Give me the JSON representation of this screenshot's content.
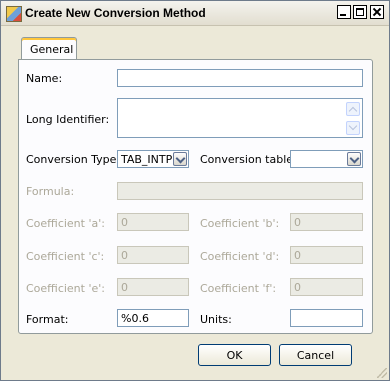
{
  "window": {
    "title": "Create New Conversion Method"
  },
  "tabs": [
    {
      "label": "General"
    }
  ],
  "form": {
    "name": {
      "label": "Name:",
      "value": ""
    },
    "long_identifier": {
      "label": "Long Identifier:",
      "value": ""
    },
    "conversion_type": {
      "label": "Conversion Type:",
      "value": "TAB_INTP"
    },
    "conversion_table": {
      "label": "Conversion table:",
      "value": ""
    },
    "formula": {
      "label": "Formula:",
      "value": ""
    },
    "coef_a": {
      "label": "Coefficient 'a':",
      "value": "0"
    },
    "coef_b": {
      "label": "Coefficient 'b':",
      "value": "0"
    },
    "coef_c": {
      "label": "Coefficient 'c':",
      "value": "0"
    },
    "coef_d": {
      "label": "Coefficient 'd':",
      "value": "0"
    },
    "coef_e": {
      "label": "Coefficient 'e':",
      "value": "0"
    },
    "coef_f": {
      "label": "Coefficient 'f':",
      "value": "0"
    },
    "format": {
      "label": "Format:",
      "value": "%0.6"
    },
    "units": {
      "label": "Units:",
      "value": ""
    }
  },
  "buttons": {
    "ok": "OK",
    "cancel": "Cancel"
  },
  "icons": {
    "app": "app-icon",
    "minimize": "minimize-icon",
    "maximize": "maximize-icon",
    "close": "close-icon",
    "scroll_up": "scroll-up-icon",
    "scroll_down": "scroll-down-icon",
    "dropdown": "chevron-down-icon",
    "resize": "resize-grip-icon"
  },
  "colors": {
    "window_bg": "#ece9d8",
    "panel_bg": "#fcfcfe",
    "input_border": "#7f9db9",
    "disabled_text": "#aca899",
    "button_border": "#003c74"
  }
}
